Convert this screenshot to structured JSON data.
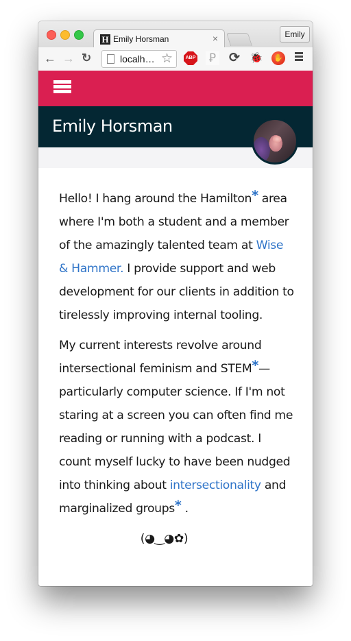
{
  "browser": {
    "tab": {
      "favicon": "H",
      "title": "Emily Horsman",
      "close": "×"
    },
    "profile": "Emily",
    "nav": {
      "back": "←",
      "forward": "→",
      "reload": "↻"
    },
    "address": {
      "text": "localh…",
      "star": "☆"
    },
    "extensions": [
      {
        "name": "adblock-plus",
        "label": "ABP"
      },
      {
        "name": "text-plugin",
        "label": "Ꝑ"
      },
      {
        "name": "sync",
        "label": "⟳"
      },
      {
        "name": "bug",
        "label": "🐞"
      },
      {
        "name": "hand-stop",
        "label": "✋"
      }
    ]
  },
  "site": {
    "title": "Emily Horsman",
    "accent_color": "#da1f51",
    "header_color": "#042733",
    "link_color": "#2f74c8"
  },
  "content": {
    "p1": {
      "t1": "Hello! I hang around the Hamilton",
      "ast1": "*",
      "t2": " area where I'm both a student and a member of the amazingly talented team at ",
      "link": "Wise & Hammer.",
      "t3": " I provide support and web development for our clients in addition to tirelessly improving internal tooling."
    },
    "p2": {
      "t1": "My current interests revolve around intersectional feminism and STEM",
      "ast1": "*",
      "t2": "—particularly computer science. If I'm not staring at a screen you can often find me reading or running with a podcast. I count myself lucky to have been nudged into thinking about ",
      "link": "intersectionality",
      "t3": " and marginalized groups",
      "ast2": "*",
      "t4": " ."
    },
    "kaomoji": "(◕‿◕✿)"
  }
}
